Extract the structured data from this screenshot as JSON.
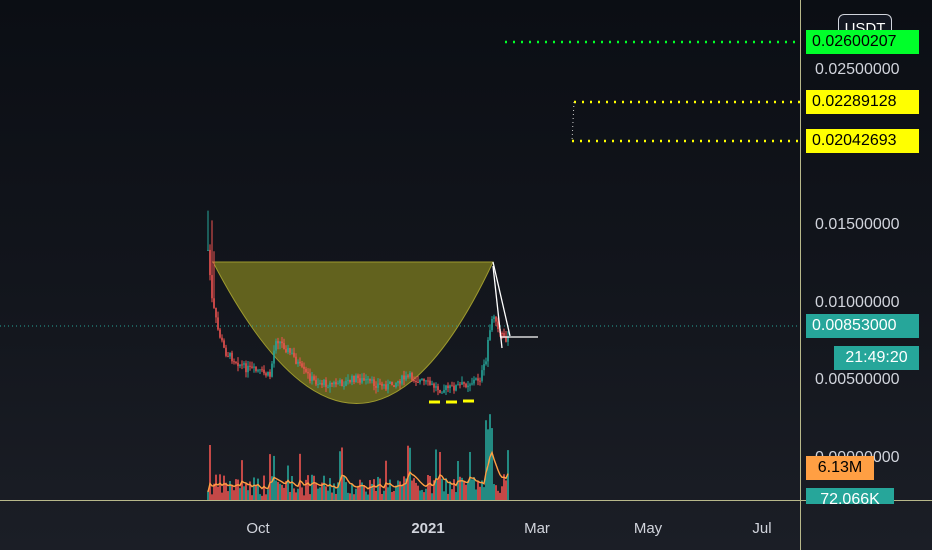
{
  "currency_button": "USDT",
  "price_axis": {
    "ticks": [
      "0.02500000",
      "0.01500000",
      "0.01000000",
      "0.00500000",
      "0.00000000"
    ]
  },
  "price_labels": {
    "green_target": "0.02600207",
    "yellow_upper": "0.02289128",
    "yellow_lower": "0.02042693",
    "current_price": "0.00853000",
    "countdown": "21:49:20",
    "volume_orange": "6.13M",
    "volume_teal": "72.066K"
  },
  "time_axis": {
    "labels": [
      "Oct",
      "2021",
      "Mar",
      "May",
      "Jul"
    ]
  },
  "colors": {
    "bull": "#26a69a",
    "bear": "#ef5350",
    "target_green": "#00ff2a",
    "target_yellow": "#ffff00",
    "cup_fill": "#6b6a1f",
    "volume_ma": "#ff9f43",
    "current_price_line": "#26a69a"
  },
  "chart_data": {
    "type": "candlestick",
    "levels": {
      "green_target": 0.02600207,
      "yellow_upper": 0.02289128,
      "yellow_lower": 0.02042693,
      "current_price": 0.00853
    },
    "y_range": [
      0,
      0.0325
    ],
    "x_range": [
      "Aug",
      "Jul"
    ],
    "patterns": [
      "cup-and-handle",
      "descending-wedge",
      "support-dashes"
    ]
  }
}
